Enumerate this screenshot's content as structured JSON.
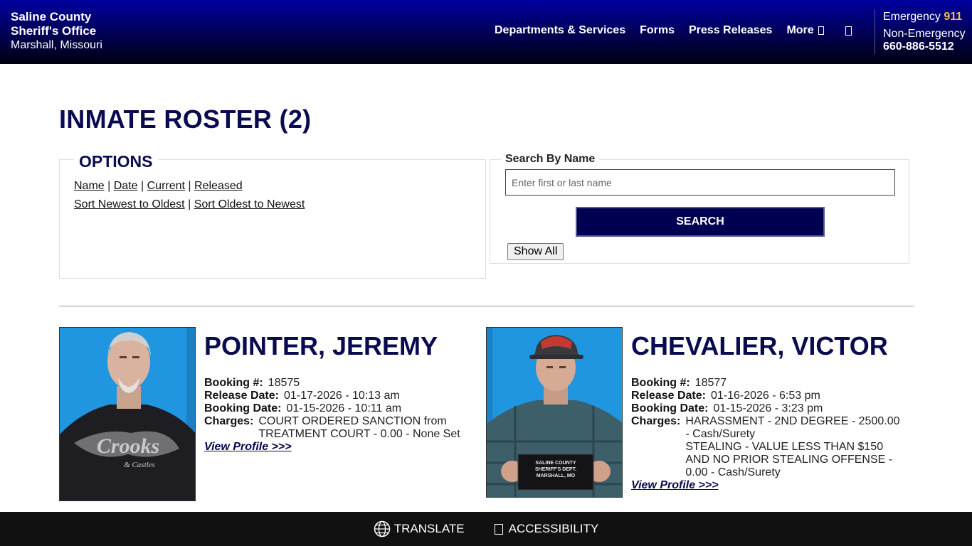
{
  "header": {
    "brand_line1": "Saline County",
    "brand_line2": "Sheriff's Office",
    "brand_city": "Marshall, Missouri",
    "nav": {
      "departments": "Departments & Services",
      "forms": "Forms",
      "press": "Press Releases",
      "more": "More"
    },
    "emergency_label": "Emergency",
    "emergency_number": "911",
    "nonemergency_label": "Non-Emergency",
    "nonemergency_number": "660-886-5512"
  },
  "page": {
    "title": "INMATE ROSTER (2)"
  },
  "options": {
    "legend": "OPTIONS",
    "sort_links": [
      "Name",
      "Date",
      "Current",
      "Released"
    ],
    "order_links": [
      "Sort Newest to Oldest",
      "Sort Oldest to Newest"
    ],
    "separator": "|"
  },
  "search": {
    "legend": "Search By Name",
    "placeholder": "Enter first or last name",
    "button": "SEARCH",
    "show_all": "Show All"
  },
  "inmates": [
    {
      "name": "POINTER, JEREMY",
      "booking_label": "Booking #:",
      "booking_number": "18575",
      "release_label": "Release Date:",
      "release_date": "01-17-2026 - 10:13 am",
      "booking_date_label": "Booking Date:",
      "booking_date": "01-15-2026 - 10:11 am",
      "charges_label": "Charges:",
      "charges": [
        "COURT ORDERED SANCTION from TREATMENT COURT - 0.00 - None Set"
      ],
      "link": "View Profile >>>",
      "shirt_text": "Crooks",
      "shirt_subtext": "& Castles"
    },
    {
      "name": "CHEVALIER, VICTOR",
      "booking_label": "Booking #:",
      "booking_number": "18577",
      "release_label": "Release Date:",
      "release_date": "01-16-2026 - 6:53 pm",
      "booking_date_label": "Booking Date:",
      "booking_date": "01-15-2026 - 3:23 pm",
      "charges_label": "Charges:",
      "charges": [
        "HARASSMENT - 2ND DEGREE - 2500.00 - Cash/Surety",
        "STEALING - VALUE LESS THAN $150 AND NO PRIOR STEALING OFFENSE - 0.00 - Cash/Surety"
      ],
      "link": "View Profile >>>",
      "placard_line1": "SALINE COUNTY",
      "placard_line2": "SHERIFF'S DEPT.",
      "placard_line3": "MARSHALL, MO"
    }
  ],
  "footer": {
    "translate": "TRANSLATE",
    "accessibility": "ACCESSIBILITY"
  },
  "colors": {
    "header_top": "#0000a0",
    "header_bottom": "#000010",
    "title": "#0a0a50",
    "emergency_accent": "#f3c14a",
    "button": "#000050",
    "footer": "#111111",
    "photo_bg": "#2196e0"
  }
}
